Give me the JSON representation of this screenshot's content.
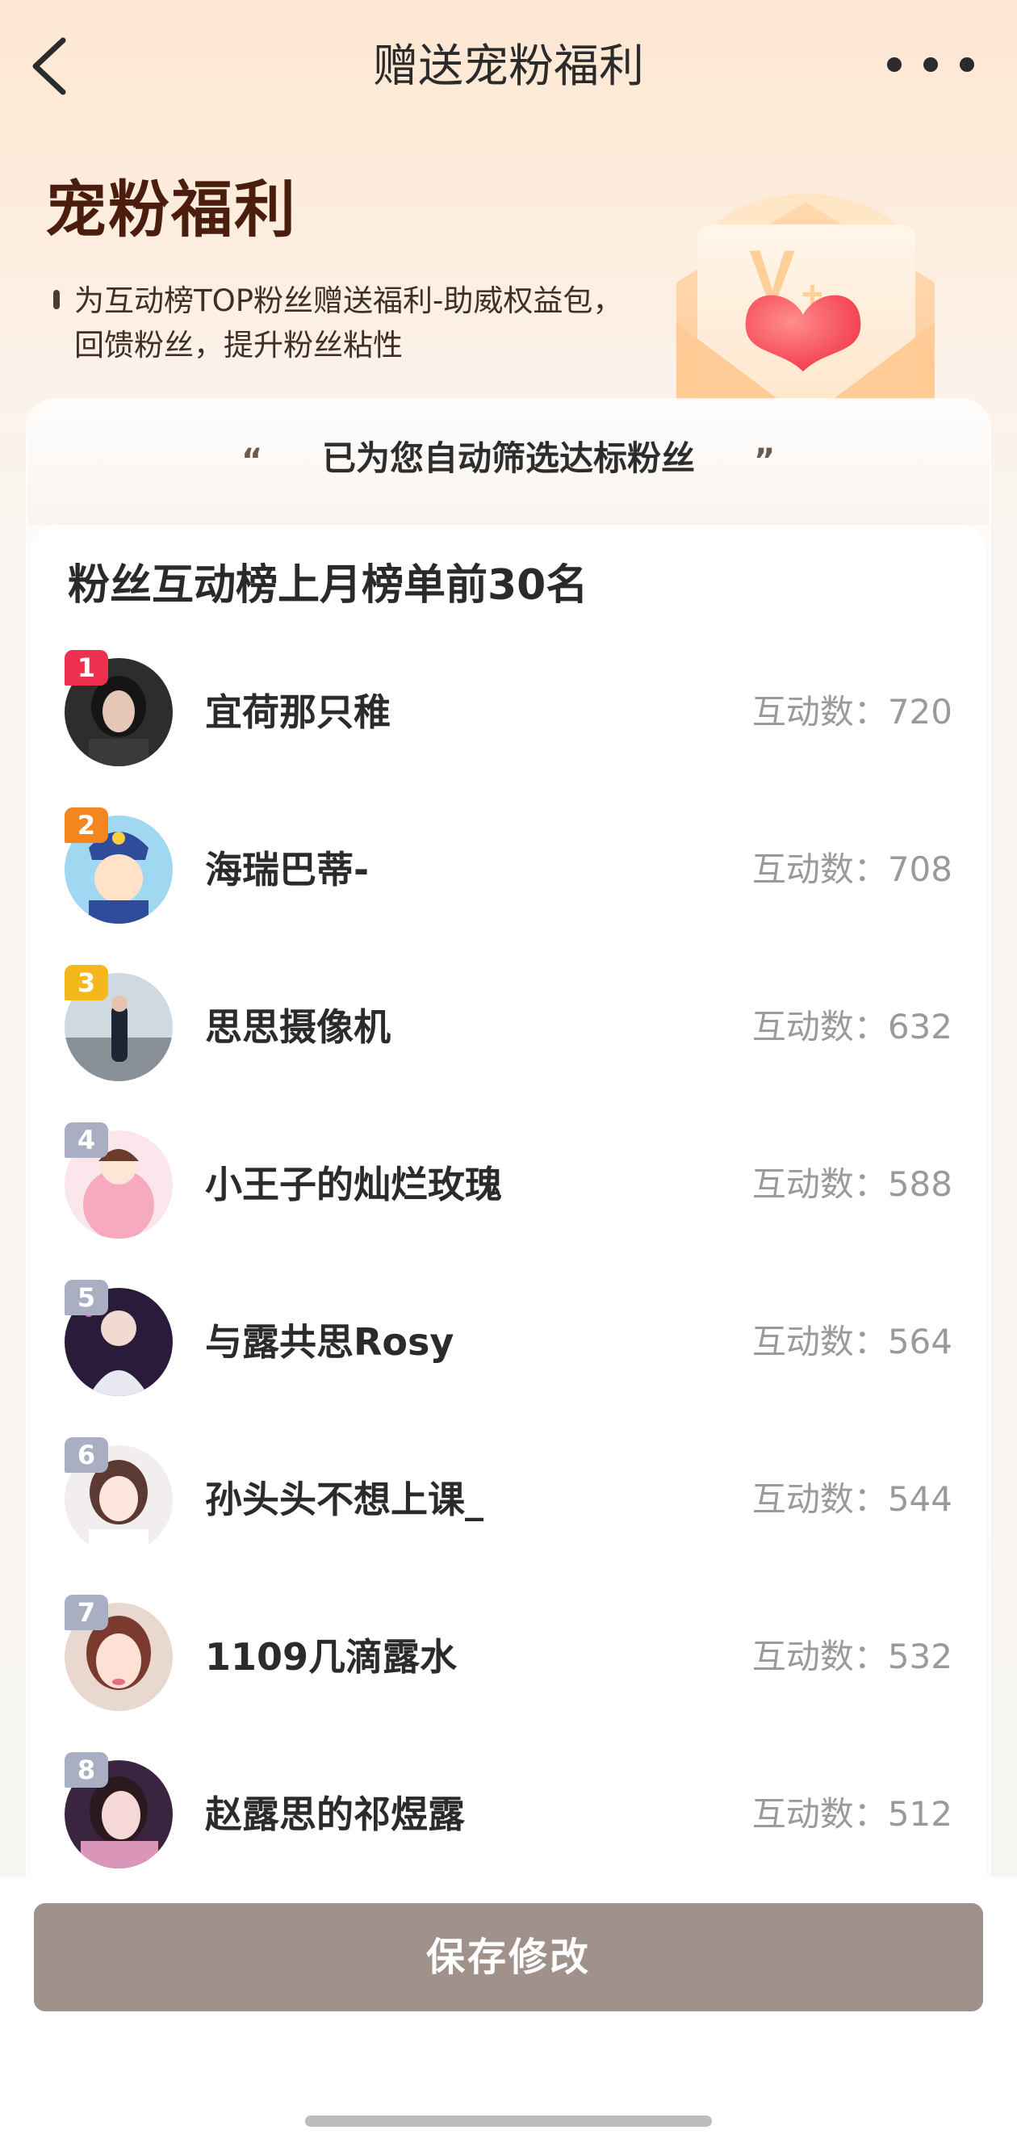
{
  "nav": {
    "title": "赠送宠粉福利"
  },
  "hero": {
    "title": "宠粉福利",
    "description_line1": "为互动榜TOP粉丝赠送福利-助威权益包，",
    "description_line2": "回馈粉丝，提升粉丝粘性",
    "envelope_badge": "V"
  },
  "card": {
    "header": "已为您自动筛选达标粉丝",
    "quote_left": "“",
    "quote_right": "”",
    "list_title": "粉丝互动榜上月榜单前30名",
    "count_prefix": "互动数：",
    "rows": [
      {
        "rank": "1",
        "name": "宜荷那只稚",
        "count": "720"
      },
      {
        "rank": "2",
        "name": "海瑞巴蒂-",
        "count": "708"
      },
      {
        "rank": "3",
        "name": "思思摄像机",
        "count": "632"
      },
      {
        "rank": "4",
        "name": "小王子的灿烂玫瑰",
        "count": "588"
      },
      {
        "rank": "5",
        "name": "与露共思Rosy",
        "count": "564"
      },
      {
        "rank": "6",
        "name": "孙头头不想上课_",
        "count": "544"
      },
      {
        "rank": "7",
        "name": "1109几滴露水",
        "count": "532"
      },
      {
        "rank": "8",
        "name": "赵露思的祁煜露",
        "count": "512"
      }
    ]
  },
  "footer": {
    "save_label": "保存修改"
  },
  "colors": {
    "rank1": "#f0304f",
    "rank2": "#f4861f",
    "rank3": "#f4b81c",
    "rank_other": "#a9aec2",
    "save_button": "#a0918a",
    "title_brown": "#4b1d0c"
  },
  "icons": {
    "back": "chevron-left-icon",
    "more": "more-dots-icon",
    "envelope": "envelope-heart-icon"
  }
}
